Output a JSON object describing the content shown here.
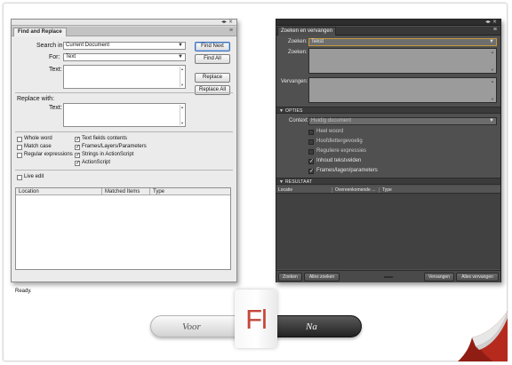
{
  "left_panel": {
    "window_controls": "◂▸ ×",
    "tab_label": "Find and Replace",
    "search_in_label": "Search in:",
    "search_in_value": "Current Document",
    "for_label": "For:",
    "for_value": "Text",
    "text_label": "Text:",
    "replace_with_label": "Replace with:",
    "replace_text_label": "Text:",
    "buttons": {
      "find_next": "Find Next",
      "find_all": "Find All",
      "replace": "Replace",
      "replace_all": "Replace All"
    },
    "options_left": [
      {
        "label": "Whole word",
        "checked": false
      },
      {
        "label": "Match case",
        "checked": false
      },
      {
        "label": "Regular expressions",
        "checked": false
      }
    ],
    "options_right": [
      {
        "label": "Text fields contents",
        "checked": true
      },
      {
        "label": "Frames/Layers/Parameters",
        "checked": true
      },
      {
        "label": "Strings in ActionScript",
        "checked": true
      },
      {
        "label": "ActionScript",
        "checked": true
      }
    ],
    "live_edit": {
      "label": "Live edit",
      "checked": false
    },
    "results_headers": [
      "Location",
      "Matched Items",
      "Type"
    ],
    "status": "Ready."
  },
  "right_panel": {
    "window_controls": "◂▸ ×",
    "tab_label": "Zoeken en vervangen",
    "zoeken_label": "Zoeken:",
    "zoeken_value": "Tekst",
    "zoeken_text_label": "Zoeken:",
    "vervangen_label": "Vervangen:",
    "opties_header": "OPTIES",
    "context_label": "Context:",
    "context_value": "Huidig document",
    "options": [
      {
        "label": "Heel woord",
        "checked": false
      },
      {
        "label": "Hoofdlettergevoelig",
        "checked": false
      },
      {
        "label": "Reguliere expressies",
        "checked": false
      },
      {
        "label": "Inhoud tekstvelden",
        "checked": true
      },
      {
        "label": "Frames/lagen/parameters",
        "checked": true
      }
    ],
    "resultaat_header": "RESULTAAT",
    "results_headers": [
      "Locatie",
      "Overeenkomende ...",
      "Type"
    ],
    "buttons": {
      "zoeken": "Zoeken",
      "alles_zoeken": "Alles zoeken",
      "vervangen": "Vervangen",
      "alles_vervangen": "Alles vervangen"
    }
  },
  "toggle": {
    "before": "Voor",
    "after": "Na",
    "logo_text": "Fl"
  },
  "colors": {
    "flash_red": "#c4473a",
    "accent_blue": "#3f6fb6",
    "dark_focus": "#c69a3b"
  }
}
